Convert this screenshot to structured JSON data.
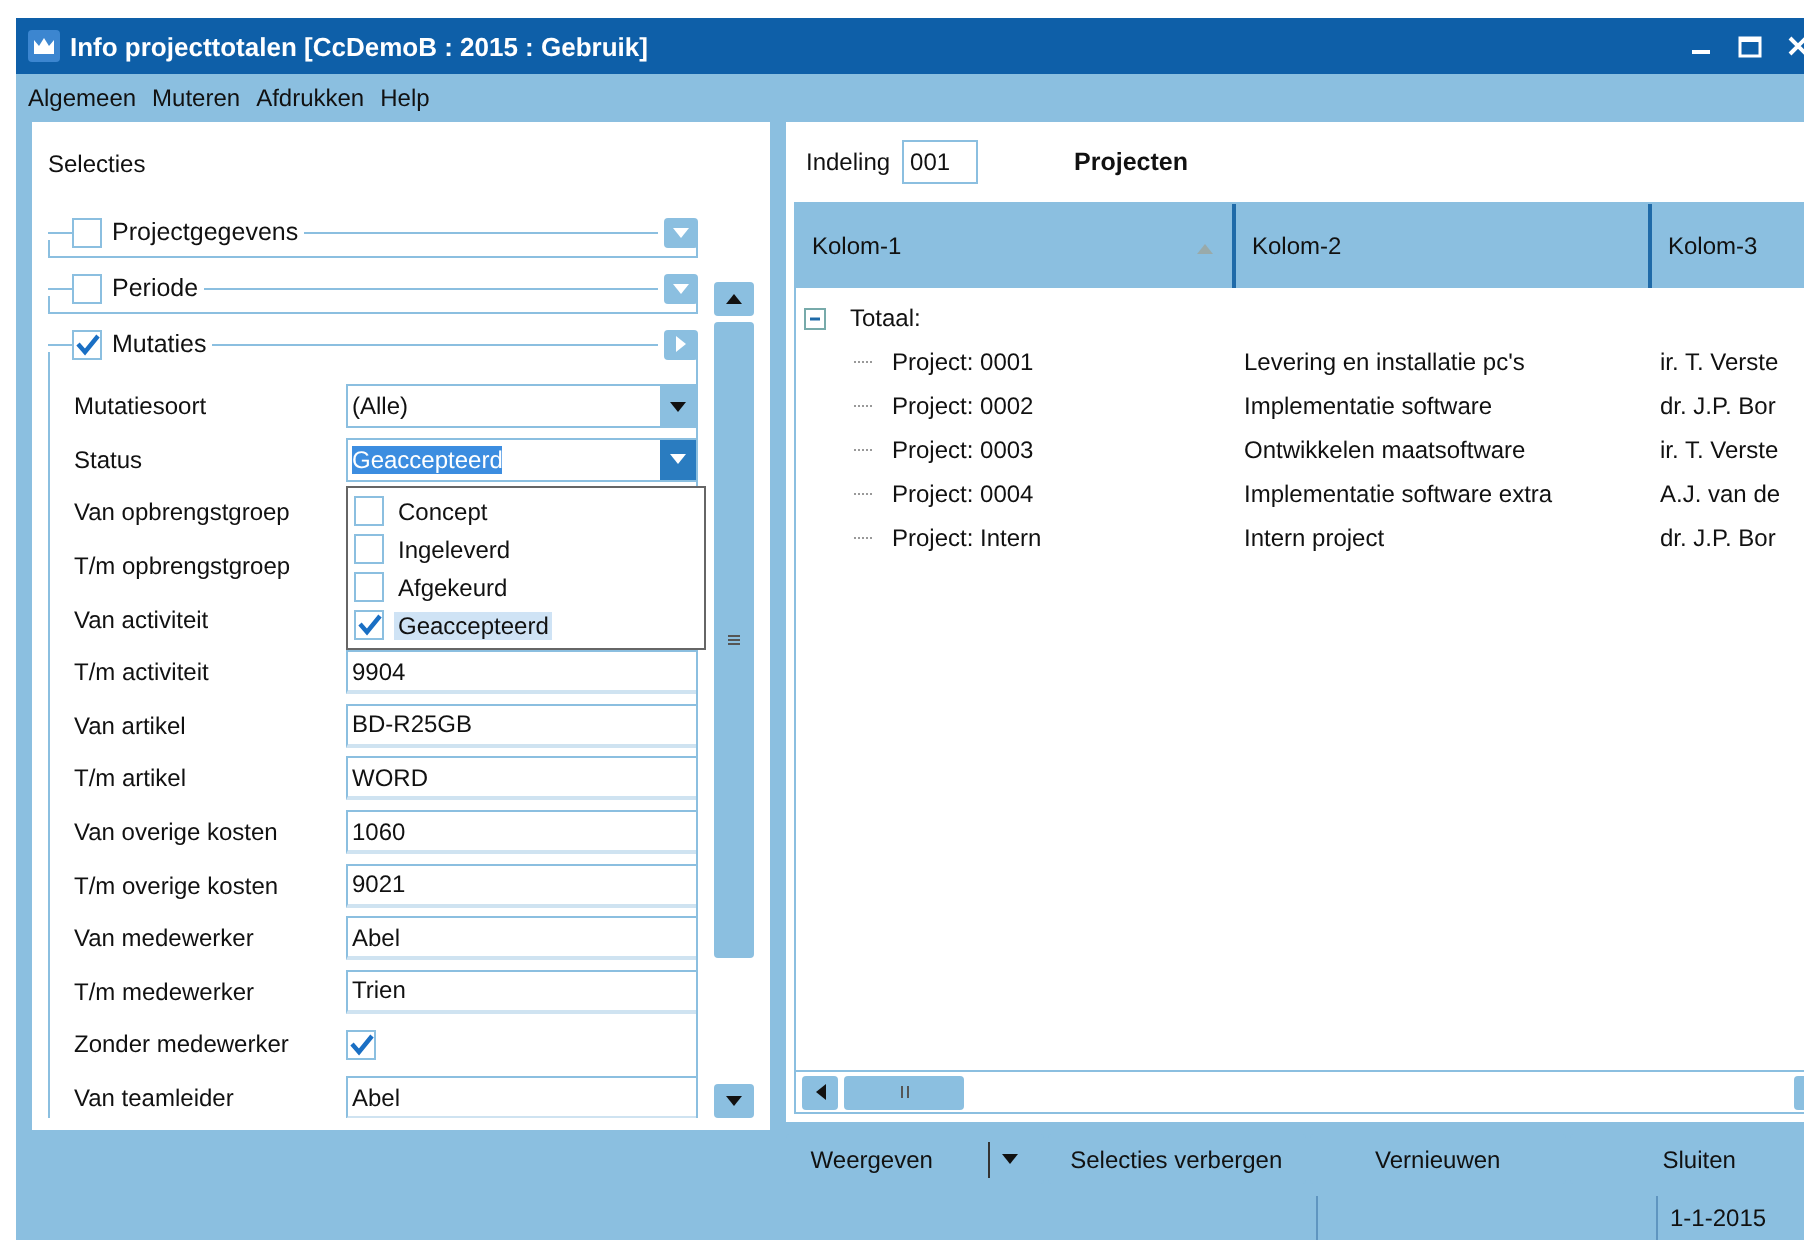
{
  "window": {
    "title": "Info projecttotalen  [CcDemoB : 2015 : Gebruik]"
  },
  "menu": [
    "Algemeen",
    "Muteren",
    "Afdrukken",
    "Help"
  ],
  "selections": {
    "title": "Selecties",
    "groups": [
      {
        "label": "Projectgegevens",
        "checked": false,
        "expanded": false
      },
      {
        "label": "Periode",
        "checked": false,
        "expanded": false
      },
      {
        "label": "Mutaties",
        "checked": true,
        "expanded": true
      }
    ],
    "fields": [
      {
        "kind": "dropdown",
        "label": "Mutatiesoort",
        "value": "(Alle)",
        "open": false
      },
      {
        "kind": "dropdown",
        "label": "Status",
        "value": "Geaccepteerd",
        "open": true,
        "options": [
          {
            "label": "Concept",
            "checked": false
          },
          {
            "label": "Ingeleverd",
            "checked": false
          },
          {
            "label": "Afgekeurd",
            "checked": false
          },
          {
            "label": "Geaccepteerd",
            "checked": true
          }
        ]
      },
      {
        "kind": "covered",
        "label": "Van opbrengstgroep"
      },
      {
        "kind": "covered",
        "label": "T/m opbrengstgroep"
      },
      {
        "kind": "covered",
        "label": "Van activiteit"
      },
      {
        "kind": "text",
        "label": "T/m activiteit",
        "value": "9904"
      },
      {
        "kind": "text",
        "label": "Van artikel",
        "value": "BD-R25GB"
      },
      {
        "kind": "text",
        "label": "T/m artikel",
        "value": "WORD"
      },
      {
        "kind": "text",
        "label": "Van overige kosten",
        "value": "1060"
      },
      {
        "kind": "text",
        "label": "T/m overige kosten",
        "value": "9021"
      },
      {
        "kind": "text",
        "label": "Van medewerker",
        "value": "Abel"
      },
      {
        "kind": "text",
        "label": "T/m medewerker",
        "value": "Trien"
      },
      {
        "kind": "checkbox",
        "label": "Zonder medewerker",
        "checked": true
      },
      {
        "kind": "text",
        "label": "Van teamleider",
        "value": "Abel"
      }
    ]
  },
  "layout": {
    "label": "Indeling",
    "value": "001",
    "title": "Projecten"
  },
  "table": {
    "columns": [
      {
        "label": "Kolom-1",
        "sorted": true
      },
      {
        "label": "Kolom-2",
        "sorted": false
      },
      {
        "label": "Kolom-3",
        "sorted": false
      }
    ],
    "tree": {
      "label": "Totaal:",
      "expanded": true,
      "children": [
        {
          "cells": [
            "Project: 0001",
            "Levering en installatie pc's",
            "ir. T. Verste"
          ]
        },
        {
          "cells": [
            "Project: 0002",
            "Implementatie software",
            "dr. J.P. Bor"
          ]
        },
        {
          "cells": [
            "Project: 0003",
            "Ontwikkelen maatsoftware",
            "ir. T. Verste"
          ]
        },
        {
          "cells": [
            "Project: 0004",
            "Implementatie software extra",
            "A.J. van de"
          ]
        },
        {
          "cells": [
            "Project: Intern",
            "Intern project",
            "dr. J.P. Bor"
          ]
        }
      ]
    }
  },
  "buttons": [
    {
      "label": "Weergeven",
      "kind": "split"
    },
    {
      "label": "Selecties verbergen",
      "kind": "plain"
    },
    {
      "label": "Vernieuwen",
      "kind": "plain"
    },
    {
      "label": "Sluiten",
      "kind": "plain"
    }
  ],
  "status_bar": {
    "date": "1-1-2015"
  }
}
